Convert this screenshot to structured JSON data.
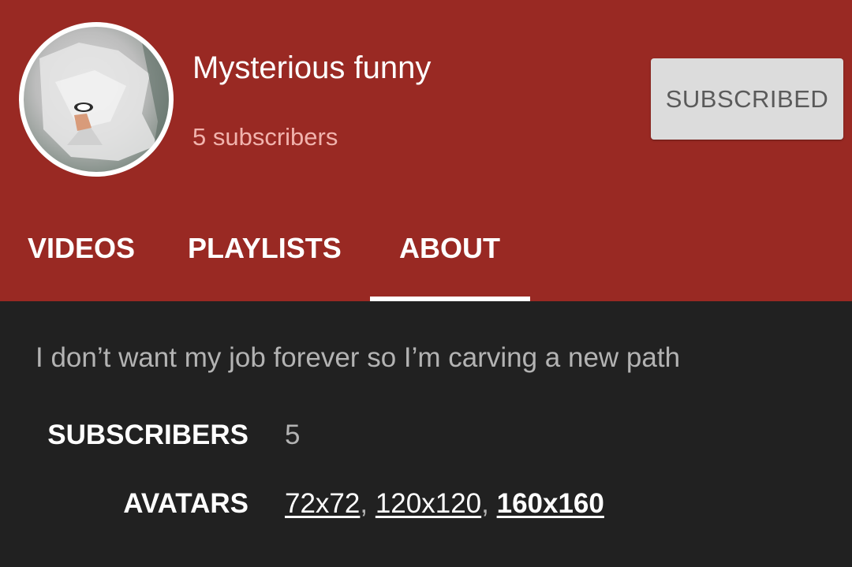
{
  "channel": {
    "name": "Mysterious funny",
    "subscriber_text": "5 subscribers",
    "subscribe_label": "SUBSCRIBED",
    "header_color": "#992923"
  },
  "tabs": [
    {
      "label": "VIDEOS",
      "active": false
    },
    {
      "label": "PLAYLISTS",
      "active": false
    },
    {
      "label": "ABOUT",
      "active": true
    }
  ],
  "about": {
    "description": "I don’t want my job forever so I’m carving a new  path",
    "stats": {
      "subscribers_label": "SUBSCRIBERS",
      "subscribers_value": "5",
      "avatars_label": "AVATARS",
      "avatar_sizes": [
        "72x72",
        "120x120",
        "160x160"
      ],
      "separator": ","
    }
  },
  "icons": {
    "avatar": "channel-avatar-image"
  }
}
